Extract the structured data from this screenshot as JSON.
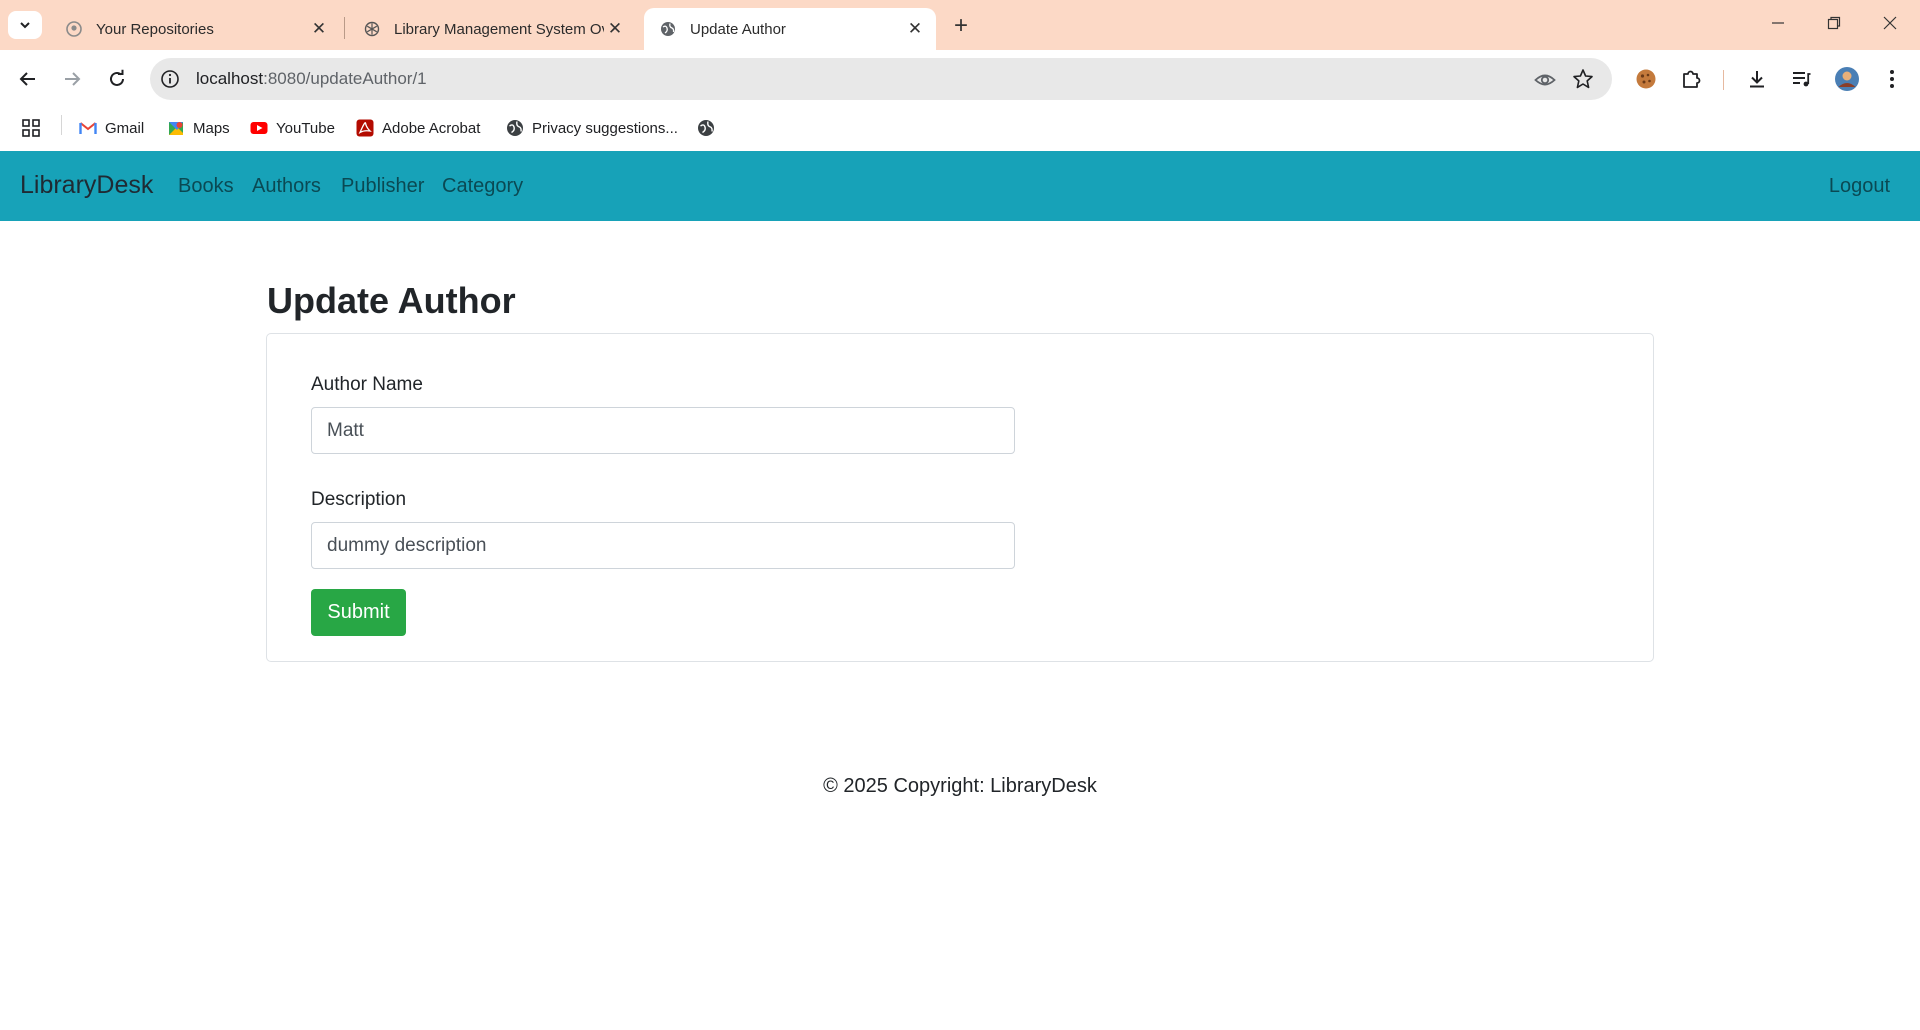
{
  "browser": {
    "tabs": [
      {
        "title": "Your Repositories",
        "icon": "github-icon",
        "active": false
      },
      {
        "title": "Library Management System Ov",
        "icon": "openai-icon",
        "active": false
      },
      {
        "title": "Update Author",
        "icon": "globe-icon",
        "active": true
      }
    ],
    "url_host": "localhost",
    "url_path": ":8080/updateAuthor/1",
    "bookmarks": [
      {
        "label": "Gmail",
        "icon": "gmail-icon"
      },
      {
        "label": "Maps",
        "icon": "maps-icon"
      },
      {
        "label": "YouTube",
        "icon": "youtube-icon"
      },
      {
        "label": "Adobe Acrobat",
        "icon": "acrobat-icon"
      },
      {
        "label": "Privacy suggestions...",
        "icon": "globe-icon"
      },
      {
        "label": "",
        "icon": "globe-icon"
      }
    ],
    "colors": {
      "tabstrip": "#fcd9c6",
      "omnibox": "#e8e8e8"
    }
  },
  "navbar": {
    "brand": "LibraryDesk",
    "links": [
      "Books",
      "Authors",
      "Publisher",
      "Category"
    ],
    "logout": "Logout",
    "color": "#17a2b8"
  },
  "main": {
    "title": "Update Author",
    "form": {
      "name_label": "Author Name",
      "name_value": "Matt",
      "description_label": "Description",
      "description_value": "dummy description",
      "submit_label": "Submit",
      "submit_color": "#28a745"
    }
  },
  "footer": {
    "text": "© 2025 Copyright: LibraryDesk"
  }
}
